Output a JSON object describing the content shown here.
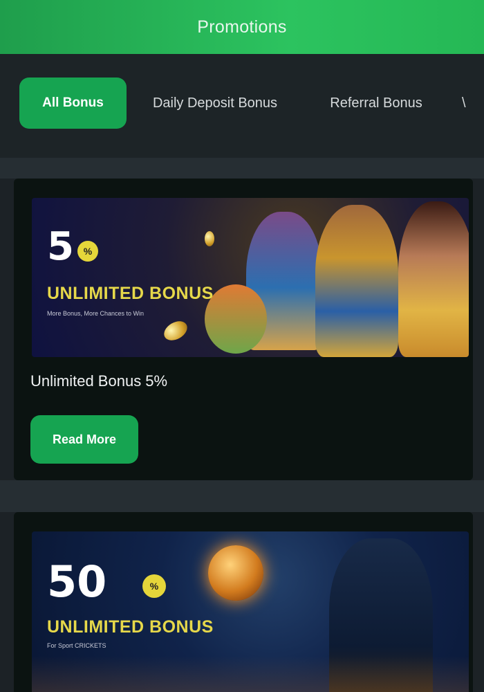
{
  "header": {
    "title": "Promotions"
  },
  "tabs": [
    {
      "label": "All Bonus",
      "active": true
    },
    {
      "label": "Daily Deposit Bonus",
      "active": false
    },
    {
      "label": "Referral Bonus",
      "active": false
    },
    {
      "label": "\\",
      "active": false
    }
  ],
  "promos": [
    {
      "percent": "5",
      "percent_sign": "%",
      "headline": "UNLIMITED BONUS",
      "subtitle": "More Bonus, More Chances to Win",
      "title": "Unlimited Bonus 5%",
      "cta_label": "Read More"
    },
    {
      "percent": "50",
      "percent_sign": "%",
      "headline": "UNLIMITED BONUS",
      "subtitle": "For Sport CRICKETS"
    }
  ],
  "colors": {
    "accent": "#16a451",
    "header_green": "#2cc35f",
    "background": "#1c2226",
    "card": "#0b1311",
    "headline_yellow": "#e6d84a"
  }
}
